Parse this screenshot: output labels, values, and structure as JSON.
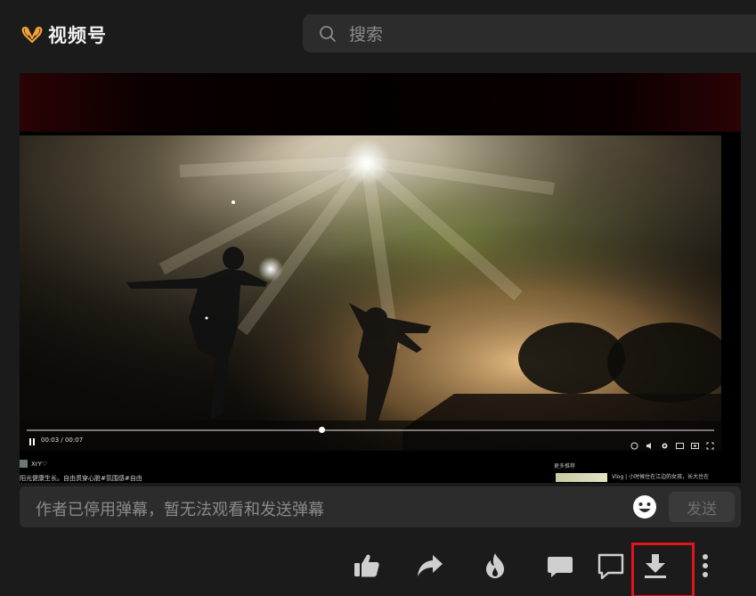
{
  "header": {
    "app_name": "视频号",
    "search_placeholder": "搜索",
    "logo_color": "#f2a03a"
  },
  "player": {
    "time": "00:03 / 00:07",
    "progress_fraction": 0.43,
    "author": "XrY♡",
    "description": "阳光健康生长。自由贯穿心脏#氛围感#自由",
    "more_title": "更多推荐",
    "recommendation": "Vlog | 小时候住在江边的女孩，长大住在"
  },
  "danmaku": {
    "disabled_text": "作者已停用弹幕，暂无法观看和发送弹幕",
    "send_label": "发送"
  },
  "actions": {
    "items": [
      "like-icon",
      "share-icon",
      "hot-icon",
      "comment-icon",
      "message-icon",
      "download-icon",
      "more-icon"
    ],
    "highlight_color": "#e0151b"
  }
}
